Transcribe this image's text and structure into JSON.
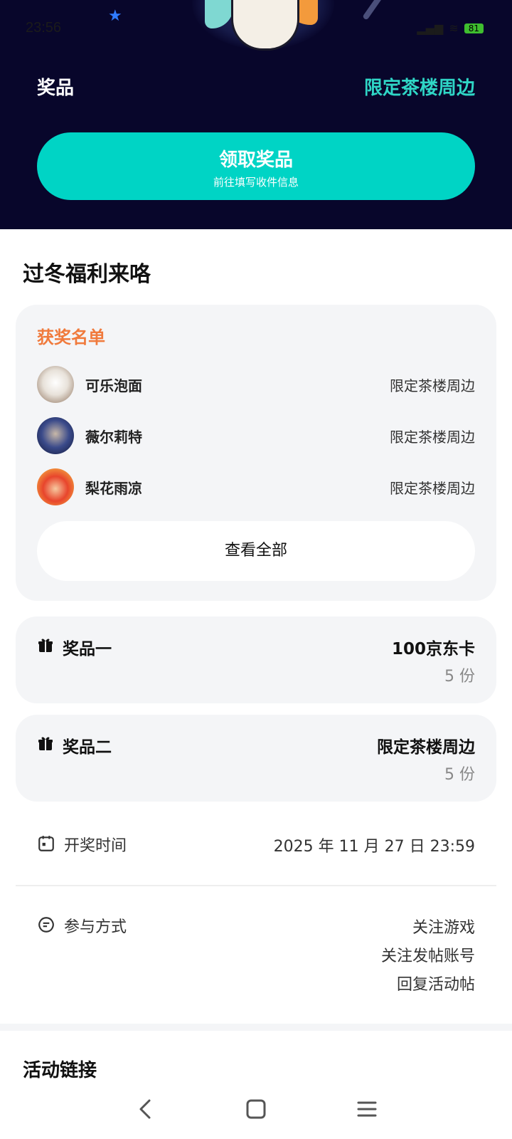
{
  "status_bar": {
    "time": "23:56",
    "battery": "81"
  },
  "hero": {
    "prize_label": "奖品",
    "prize_value": "限定茶楼周边"
  },
  "claim_button": {
    "title": "领取奖品",
    "subtitle": "前往填写收件信息"
  },
  "section_title": "过冬福利来咯",
  "winners": {
    "title": "获奖名单",
    "items": [
      {
        "name": "可乐泡面",
        "prize": "限定茶楼周边"
      },
      {
        "name": "薇尔莉特",
        "prize": "限定茶楼周边"
      },
      {
        "name": "梨花雨凉",
        "prize": "限定茶楼周边"
      }
    ],
    "view_all": "查看全部"
  },
  "prizes": [
    {
      "label": "奖品一",
      "name": "100京东卡",
      "count": "5 份"
    },
    {
      "label": "奖品二",
      "name": "限定茶楼周边",
      "count": "5 份"
    }
  ],
  "draw_time": {
    "label": "开奖时间",
    "value": "2025 年 11 月 27 日 23:59"
  },
  "participation": {
    "label": "参与方式",
    "methods": [
      "关注游戏",
      "关注发帖账号",
      "回复活动帖"
    ]
  },
  "links_title": "活动链接",
  "colors": {
    "accent": "#00d4c5",
    "hero_bg": "#08062b",
    "winner_title": "#f07a3c"
  }
}
